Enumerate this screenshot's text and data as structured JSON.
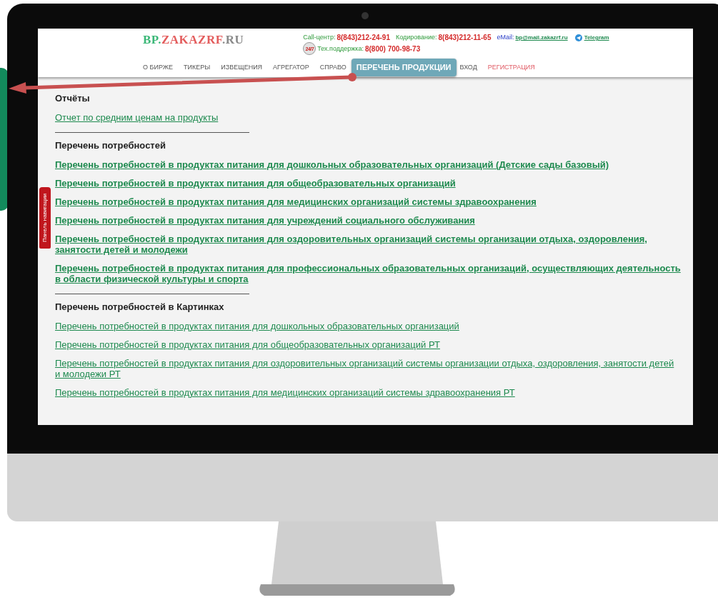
{
  "logo": [
    {
      "text": "BP.",
      "color": "#3cb878"
    },
    {
      "text": "ZAKAZRF",
      "color": "#e35d5d"
    },
    {
      "text": ".RU",
      "color": "#8a8a8a"
    }
  ],
  "contacts": {
    "line1": [
      {
        "kind": "label",
        "text": "Call-центр:"
      },
      {
        "kind": "phone",
        "text": "8(843)212-24-91"
      },
      {
        "kind": "label",
        "text": "Кодирование:"
      },
      {
        "kind": "phone",
        "text": "8(843)212-11-65"
      },
      {
        "kind": "email-label",
        "text": "eMail:"
      },
      {
        "kind": "link",
        "text": "bp@mail.zakazrf.ru"
      },
      {
        "kind": "telegram",
        "text": "Telegram"
      }
    ],
    "line2": [
      {
        "kind": "support-badge",
        "text": "24/7"
      },
      {
        "kind": "label",
        "text": "Тех.поддержка:"
      },
      {
        "kind": "phone",
        "text": "8(800) 700-98-73"
      }
    ]
  },
  "nav": [
    {
      "label": "О БИРЖЕ",
      "highlight": false
    },
    {
      "label": "ТИКЕРЫ",
      "highlight": false
    },
    {
      "label": "ИЗВЕЩЕНИЯ",
      "highlight": false
    },
    {
      "label": "АГРЕГАТОР",
      "highlight": false
    },
    {
      "label": "СПРАВО",
      "highlight": false
    },
    {
      "kind": "callout",
      "label": "ПЕРЕЧЕНЬ ПРОДУКЦИИ"
    },
    {
      "label": "ВХОД",
      "highlight": false
    },
    {
      "label": "РЕГИСТРАЦИЯ",
      "highlight": true
    }
  ],
  "side_tab": "Панель навигации",
  "sections": [
    {
      "title": "Отчёты",
      "bold": false,
      "links": [
        "Отчет по средним ценам на продукты"
      ]
    },
    {
      "title": "Перечень потребностей",
      "bold": true,
      "links": [
        "Перечень потребностей в продуктах питания для дошкольных образовательных организаций (Детские сады базовый)",
        "Перечень потребностей в продуктах питания для общеобразовательных организаций",
        "Перечень потребностей в продуктах питания для медицинских организаций системы здравоохранения",
        "Перечень потребностей в продуктах питания для учреждений социального обслуживания",
        "Перечень потребностей в продуктах питания для оздоровительных организаций системы организации отдыха, оздоровления, занятости детей и молодежи",
        "Перечень потребностей в продуктах питания для профессиональных образовательных организаций, осуществляющих деятельность в области физической культуры и спорта"
      ]
    },
    {
      "title": "Перечень потребностей в Картинках",
      "bold": false,
      "links": [
        "Перечень потребностей в продуктах питания для дошкольных образовательных организаций",
        "Перечень потребностей в продуктах питания для общеобразовательных организаций РТ",
        "Перечень потребностей в продуктах питания для оздоровительных организаций системы организации отдыха, оздоровления, занятости детей и молодежи РТ",
        "Перечень потребностей в продуктах питания для медицинских организаций системы здравоохранения РТ"
      ]
    }
  ]
}
